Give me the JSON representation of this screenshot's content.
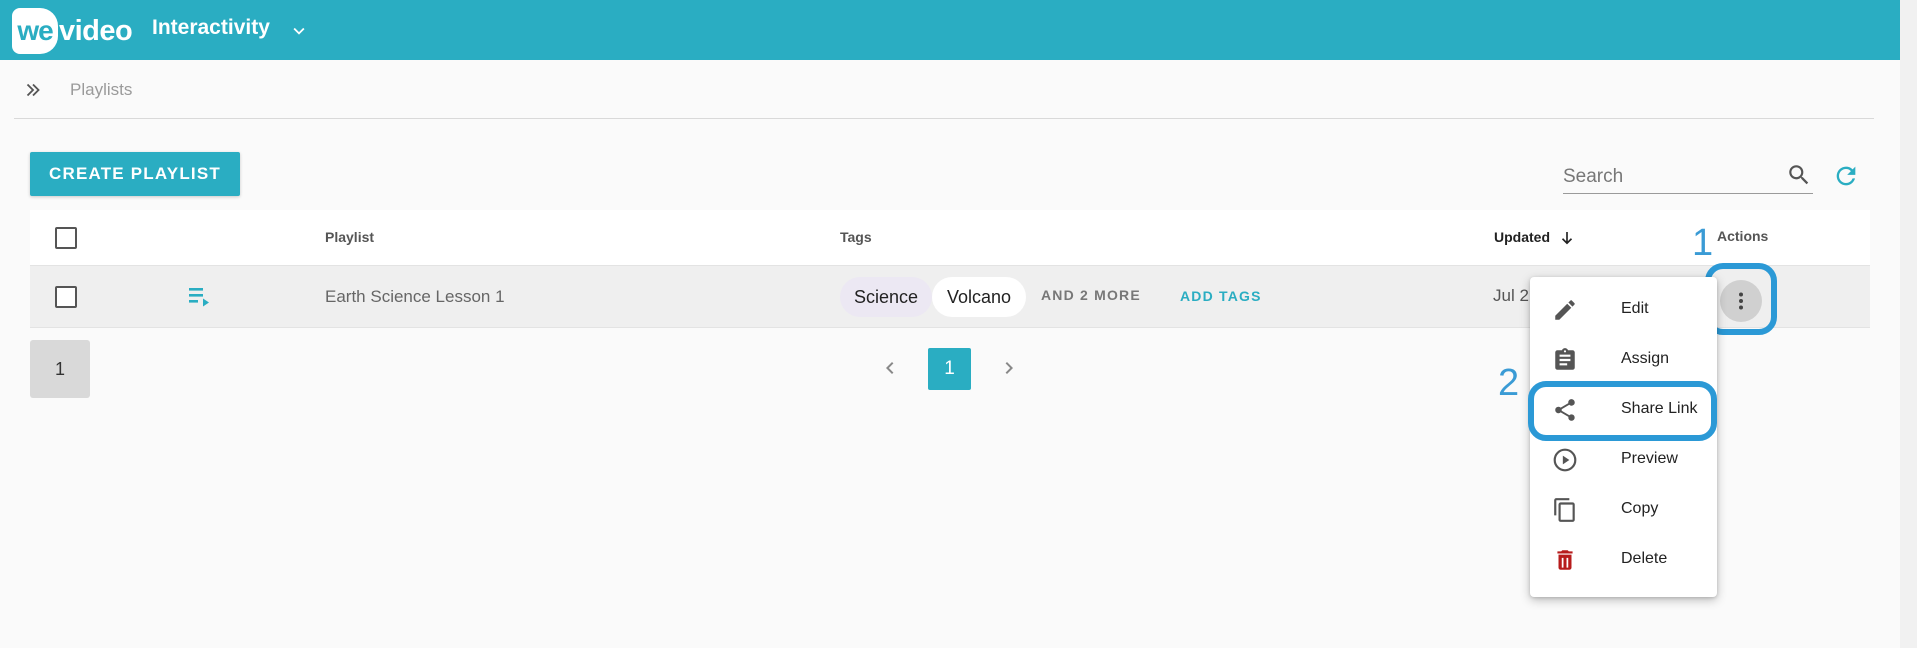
{
  "app": {
    "logo_we": "we",
    "logo_video": "video",
    "title": "Interactivity"
  },
  "breadcrumb": {
    "current": "Playlists"
  },
  "toolbar": {
    "create_label": "CREATE PLAYLIST",
    "search_placeholder": "Search"
  },
  "table": {
    "headers": {
      "playlist": "Playlist",
      "tags": "Tags",
      "updated": "Updated",
      "actions": "Actions"
    },
    "rows": [
      {
        "name": "Earth Science Lesson 1",
        "tags": [
          "Science",
          "Volcano"
        ],
        "more_tags": "AND 2 MORE",
        "add_tags": "ADD TAGS",
        "updated": "Jul 2"
      }
    ]
  },
  "pagination": {
    "page_size": "1",
    "current_page": "1"
  },
  "actions_menu": {
    "items": [
      {
        "label": "Edit",
        "icon": "pencil-icon"
      },
      {
        "label": "Assign",
        "icon": "clipboard-icon"
      },
      {
        "label": "Share Link",
        "icon": "share-icon"
      },
      {
        "label": "Preview",
        "icon": "play-circle-icon"
      },
      {
        "label": "Copy",
        "icon": "copy-icon"
      },
      {
        "label": "Delete",
        "icon": "trash-icon"
      }
    ]
  },
  "annotations": {
    "step1": "1",
    "step2": "2"
  },
  "colors": {
    "brand": "#2aadc2",
    "highlight": "#2b99d6",
    "delete_icon": "#b71c1c",
    "tag_science_bg": "#ece8f3",
    "tag_volcano_bg": "#ffffff"
  }
}
